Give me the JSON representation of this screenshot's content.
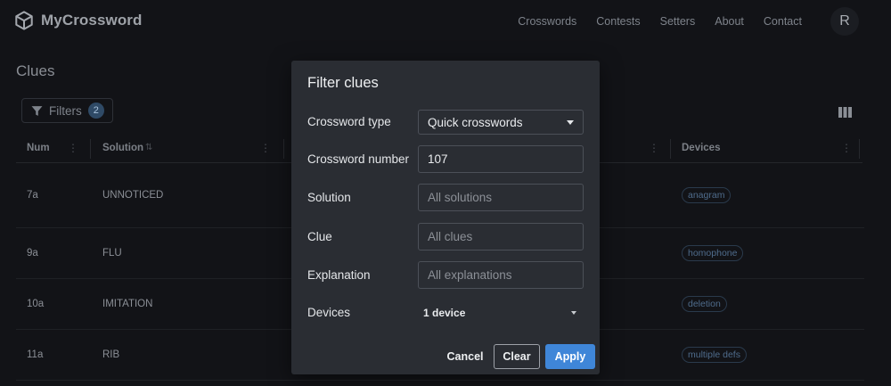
{
  "brand": {
    "name": "MyCrossword"
  },
  "nav": {
    "items": [
      "Crosswords",
      "Contests",
      "Setters",
      "About",
      "Contact"
    ]
  },
  "user": {
    "avatar_letter": "R"
  },
  "page": {
    "title": "Clues"
  },
  "filters": {
    "label": "Filters",
    "count": "2"
  },
  "table": {
    "headers": {
      "num": "Num",
      "solution": "Solution",
      "devices": "Devices"
    },
    "rows": [
      {
        "num": "7a",
        "solution": "UNNOTICED",
        "device": "anagram"
      },
      {
        "num": "9a",
        "solution": "FLU",
        "device": "homophone"
      },
      {
        "num": "10a",
        "solution": "IMITATION",
        "device": "deletion"
      },
      {
        "num": "11a",
        "solution": "RIB",
        "device": "multiple defs"
      }
    ]
  },
  "modal": {
    "title": "Filter clues",
    "crossword_type": {
      "label": "Crossword type",
      "value": "Quick crosswords"
    },
    "crossword_number": {
      "label": "Crossword number",
      "value": "107"
    },
    "solution": {
      "label": "Solution",
      "placeholder": "All solutions"
    },
    "clue": {
      "label": "Clue",
      "placeholder": "All clues"
    },
    "explanation": {
      "label": "Explanation",
      "placeholder": "All explanations"
    },
    "devices": {
      "label": "Devices",
      "value": "1 device"
    },
    "buttons": {
      "cancel": "Cancel",
      "clear": "Clear",
      "apply": "Apply"
    }
  },
  "colors": {
    "accent": "#3f86d8",
    "background": "#121317",
    "modal": "#2a2d33"
  }
}
